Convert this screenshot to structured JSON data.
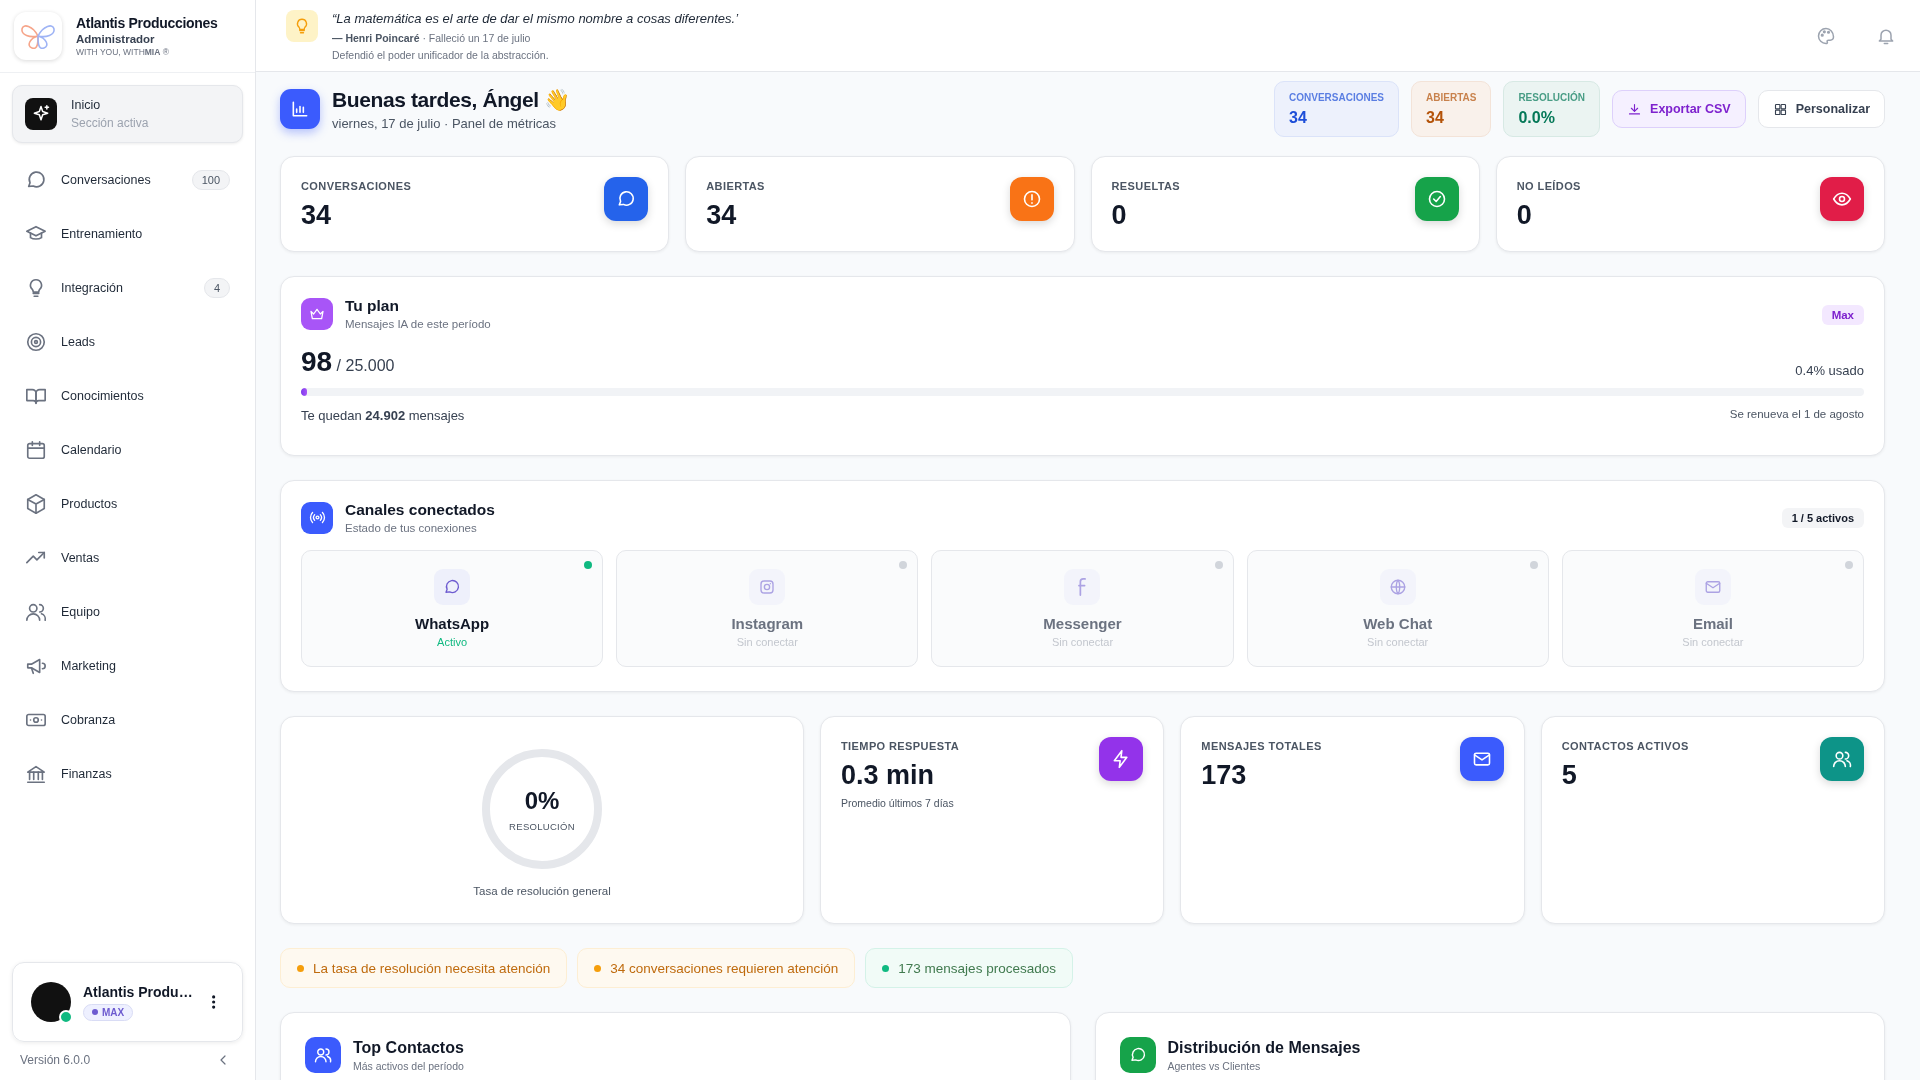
{
  "brand": {
    "name": "Atlantis Producciones",
    "role": "Administrador",
    "tagline": "WITH YOU, WITH**MIA** ®"
  },
  "nav": [
    {
      "label": "Inicio",
      "sub": "Sección activa",
      "selected": true
    },
    {
      "label": "Conversaciones",
      "badge": "100",
      "selected": false
    },
    {
      "label": "Entrenamiento",
      "selected": false
    },
    {
      "label": "Integración",
      "badge": "4",
      "selected": false
    },
    {
      "label": "Leads",
      "selected": false
    },
    {
      "label": "Conocimientos",
      "selected": false
    },
    {
      "label": "Calendario",
      "selected": false
    },
    {
      "label": "Productos",
      "selected": false
    },
    {
      "label": "Ventas",
      "selected": false
    },
    {
      "label": "Equipo",
      "selected": false
    },
    {
      "label": "Marketing",
      "selected": false
    },
    {
      "label": "Cobranza",
      "selected": false
    },
    {
      "label": "Finanzas",
      "selected": false
    }
  ],
  "profile": {
    "name": "Atlantis Produ…",
    "plan": "MAX",
    "online": true
  },
  "version": "Versión 6.0.0",
  "quote": {
    "text": "“La matemática es el arte de dar el mismo nombre a cosas diferentes.’",
    "byline": "**— Henri Poincaré** · Falleció un 17 de julio",
    "note": "Defendió el poder unificador de la abstracción."
  },
  "header": {
    "greeting": "Buenas tardes, Ángel",
    "wave": "👋",
    "subtitle": "viernes, 17 de julio · Panel de métricas"
  },
  "summary": [
    {
      "label": "CONVERSACIONES",
      "value": "34",
      "color": "#1d4ed8"
    },
    {
      "label": "ABIERTAS",
      "value": "34",
      "color": "#b45309"
    },
    {
      "label": "RESOLUCIÓN",
      "value": "0.0%",
      "color": "#047857"
    }
  ],
  "actions": [
    {
      "label": "Exportar CSV",
      "kind": "primary"
    },
    {
      "label": "Personalizar",
      "kind": "secondary"
    }
  ],
  "stats": [
    {
      "label": "CONVERSACIONES",
      "value": "34",
      "color": "#2563eb"
    },
    {
      "label": "ABIERTAS",
      "value": "34",
      "color": "#f97316"
    },
    {
      "label": "RESUELTAS",
      "value": "0",
      "color": "#16a34a"
    },
    {
      "label": "NO LEÍDOS",
      "value": "0",
      "color": "#e11d48"
    }
  ],
  "plan": {
    "title": "Tu plan",
    "subtitle": "Mensajes IA de este período",
    "badge": "Max",
    "used": "98",
    "total": "/ 25.000",
    "usage": "0.4% usado",
    "level": 0.0039,
    "remaining": "Te quedan **24.902** mensajes",
    "renewal": "Se renueva el 1 de agosto"
  },
  "channels": {
    "title": "Canales conectados",
    "subtitle": "Estado de tus conexiones",
    "count": "1 / 5 activos",
    "items": [
      {
        "name": "WhatsApp",
        "status": "Activo",
        "connected": true
      },
      {
        "name": "Instagram",
        "status": "Sin conectar",
        "connected": false
      },
      {
        "name": "Messenger",
        "status": "Sin conectar",
        "connected": false
      },
      {
        "name": "Web Chat",
        "status": "Sin conectar",
        "connected": false
      },
      {
        "name": "Email",
        "status": "Sin conectar",
        "connected": false
      }
    ]
  },
  "resolution": {
    "value": "0%",
    "label": "RESOLUCIÓN",
    "caption": "Tasa de resolución general",
    "level": 0
  },
  "metrics": [
    {
      "label": "TIEMPO RESPUESTA",
      "value": "0.3 min",
      "note": "Promedio últimos 7 días",
      "color": "#9333ea"
    },
    {
      "label": "MENSAJES TOTALES",
      "value": "173",
      "color": "#3b5bfd"
    },
    {
      "label": "CONTACTOS ACTIVOS",
      "value": "5",
      "color": "#0d9488"
    }
  ],
  "alerts": [
    {
      "text": "La tasa de resolución necesita atención",
      "color": "#f59e0b"
    },
    {
      "text": "34 conversaciones requieren atención",
      "color": "#f59e0b"
    },
    {
      "text": "173 mensajes procesados",
      "color": "#10b981"
    }
  ],
  "panels": [
    {
      "title": "Top Contactos",
      "subtitle": "Más activos del período",
      "color": "#3b5bfd"
    },
    {
      "title": "Distribución de Mensajes",
      "subtitle": "Agentes vs Clientes",
      "color": "#16a34a"
    }
  ]
}
